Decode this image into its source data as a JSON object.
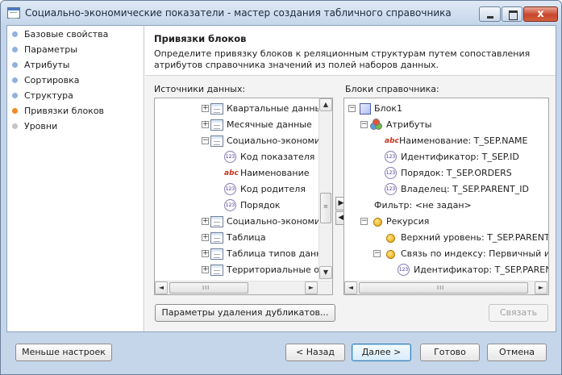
{
  "window": {
    "title": "Социально-экономические показатели - мастер создания табличного справочника",
    "close_glyph": "x"
  },
  "nav": {
    "items": [
      {
        "label": "Базовые свойства",
        "state": "done"
      },
      {
        "label": "Параметры",
        "state": "done"
      },
      {
        "label": "Атрибуты",
        "state": "done"
      },
      {
        "label": "Сортировка",
        "state": "done"
      },
      {
        "label": "Структура",
        "state": "done"
      },
      {
        "label": "Привязки блоков",
        "state": "active"
      },
      {
        "label": "Уровни",
        "state": "pending"
      }
    ]
  },
  "page": {
    "title": "Привязки блоков",
    "description": "Определите привязку блоков к реляционным структурам путем сопоставления атрибутов справочника значений из полей наборов данных."
  },
  "sources": {
    "label": "Источники данных:",
    "items": [
      {
        "text": "Квартальные данные",
        "icon": "table-icon",
        "expander": "+"
      },
      {
        "text": "Месячные данные",
        "icon": "table-icon",
        "expander": "+"
      },
      {
        "text": "Социально-экономи",
        "icon": "table-icon",
        "expander": "−"
      },
      {
        "text": "Код показателя",
        "icon": "numeric-field-icon",
        "glyph": "123"
      },
      {
        "text": "Наименование",
        "icon": "text-field-icon",
        "glyph": "abc"
      },
      {
        "text": "Код родителя",
        "icon": "numeric-field-icon",
        "glyph": "123"
      },
      {
        "text": "Порядок",
        "icon": "numeric-field-icon",
        "glyph": "123"
      },
      {
        "text": "Социально-экономи",
        "icon": "table-icon",
        "expander": "+"
      },
      {
        "text": "Таблица",
        "icon": "table-icon",
        "expander": "+"
      },
      {
        "text": "Таблица типов данн",
        "icon": "table-icon",
        "expander": "+"
      },
      {
        "text": "Территориальные об",
        "icon": "table-icon",
        "expander": "+"
      }
    ]
  },
  "blocks": {
    "label": "Блоки справочника:",
    "items": [
      {
        "text": "Блок1",
        "icon": "block-icon",
        "expander": "−"
      },
      {
        "text": "Атрибуты",
        "icon": "attributes-icon",
        "expander": "−"
      },
      {
        "text": "Наименование: T_SEP.NAME",
        "icon": "text-field-icon",
        "glyph": "abc"
      },
      {
        "text": "Идентификатор: T_SEP.ID",
        "icon": "numeric-field-icon",
        "glyph": "123"
      },
      {
        "text": "Порядок: T_SEP.ORDERS",
        "icon": "numeric-field-icon",
        "glyph": "123"
      },
      {
        "text": "Владелец: T_SEP.PARENT_ID",
        "icon": "numeric-field-icon",
        "glyph": "123"
      },
      {
        "text": "Фильтр: <не задан>",
        "icon": "none"
      },
      {
        "text": "Рекурсия",
        "icon": "yellow-dot-icon",
        "expander": "−"
      },
      {
        "text": "Верхний уровень: T_SEP.PARENT_I",
        "icon": "yellow-dot-icon"
      },
      {
        "text": "Связь по индексу: Первичный ин",
        "icon": "yellow-dot-icon",
        "expander": "−"
      },
      {
        "text": "Идентификатор: T_SEP.PARENT",
        "icon": "numeric-field-icon",
        "glyph": "123"
      }
    ]
  },
  "scroll": {
    "up": "▲",
    "down": "▼",
    "left": "◄",
    "right": "►",
    "grip": "≡",
    "hgrip": "III"
  },
  "arrows": {
    "add": "▶",
    "remove": "◀"
  },
  "buttons": {
    "remove_duplicates": "Параметры удаления дубликатов...",
    "link": "Связать",
    "less_settings": "Меньше настроек",
    "back": "< Назад",
    "next": "Далее >",
    "finish": "Готово",
    "cancel": "Отмена"
  },
  "colors": {
    "accent_active": "#f08a24",
    "nav_done": "#8fb2de",
    "nav_pending": "#c4c4c4",
    "window_frame": "#c5d6ea"
  }
}
